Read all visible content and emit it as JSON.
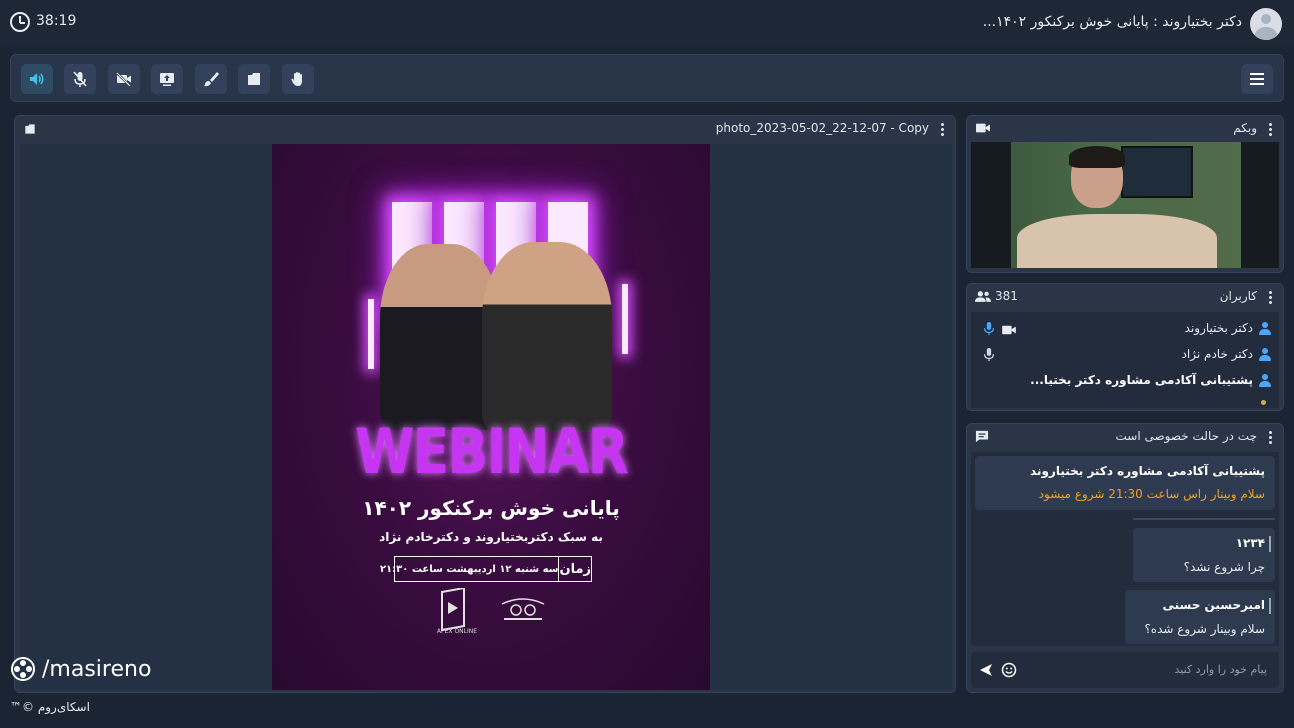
{
  "topbar": {
    "timer": "38:19",
    "room_title": "دکتر بختیاروند : پایانی خوش برکنکور ۱۴۰۲..."
  },
  "toolbar": {
    "buttons": [
      "speaker-icon",
      "mic-muted-icon",
      "camera-off-icon",
      "screen-share-icon",
      "brush-icon",
      "document-icon",
      "raise-hand-icon"
    ],
    "active_color": "#3fc3e8"
  },
  "presentation": {
    "filename": "photo_2023-05-02_22-12-07 - Copy",
    "poster": {
      "headline": "WEBINAR",
      "title": "پایانی خوش برکنکور ۱۴۰۲",
      "subtitle": "به سبک دکتربختیاروند و دکترخادم نژاد",
      "time_label": "زمان",
      "time_value": "سه شنبه ۱۲ اردیبهشت ساعت ۲۱:۳۰",
      "logo_left": "APEX ONLINE"
    }
  },
  "webcam": {
    "title": "وبکم"
  },
  "users": {
    "title": "کاربران",
    "count": "381",
    "list": [
      {
        "name": "دکتر بختیاروند",
        "bold": false
      },
      {
        "name": "دکتر خادم نژاد",
        "bold": false
      },
      {
        "name": "پشتیبانی آکادمی مشاوره دکتر بختیا...",
        "bold": true
      }
    ]
  },
  "chat": {
    "title": "چت در حالت خصوصی است",
    "messages": [
      {
        "author": "پشتیبانی آکادمی مشاوره دکتر بختیاروند",
        "text": "سلام وبینار راس ساعت 21:30 شروع میشود",
        "highlight": "#f0a020"
      },
      {
        "author": "۱۲۳۴",
        "text": "چرا شروع نشد؟"
      },
      {
        "author": "امیرحسین حسنی",
        "text": "سلام وبینار شروع شده؟"
      }
    ],
    "input_placeholder": "پیام خود را وارد کنید"
  },
  "watermark": "/masireno",
  "brand": "اسکای‌روم ©™"
}
